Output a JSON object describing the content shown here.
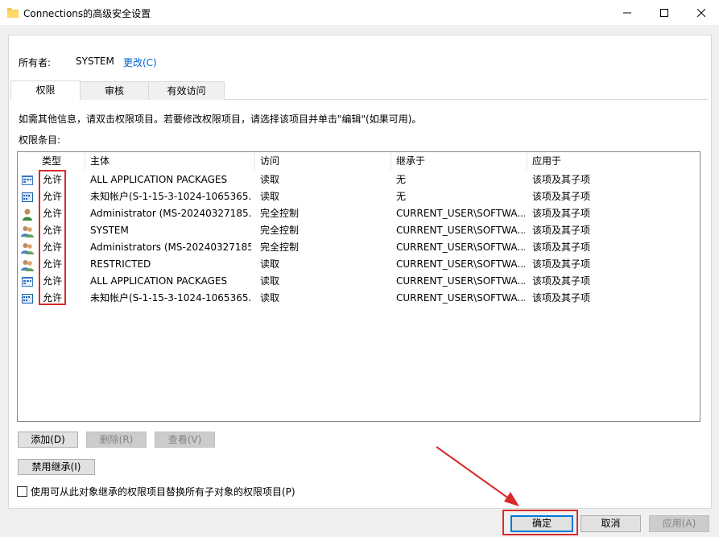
{
  "window": {
    "title": "Connections的高级安全设置",
    "minimize_icon": "minimize-icon",
    "maximize_icon": "maximize-icon",
    "close_icon": "close-icon"
  },
  "owner": {
    "label": "所有者:",
    "value": "SYSTEM",
    "change_link": "更改(C)"
  },
  "tabs": [
    {
      "label": "权限",
      "active": true
    },
    {
      "label": "审核",
      "active": false
    },
    {
      "label": "有效访问",
      "active": false
    }
  ],
  "info_text": "如需其他信息，请双击权限项目。若要修改权限项目，请选择该项目并单击\"编辑\"(如果可用)。",
  "entries_label": "权限条目:",
  "columns": [
    "类型",
    "主体",
    "访问",
    "继承于",
    "应用于"
  ],
  "rows": [
    {
      "icon": "app-package-icon",
      "type": "允许",
      "principal": "ALL APPLICATION PACKAGES",
      "access": "读取",
      "inherited": "无",
      "applies": "该项及其子项"
    },
    {
      "icon": "unknown-account-icon",
      "type": "允许",
      "principal": "未知帐户(S-1-15-3-1024-1065365...",
      "access": "读取",
      "inherited": "无",
      "applies": "该项及其子项"
    },
    {
      "icon": "user-icon",
      "type": "允许",
      "principal": "Administrator (MS-20240327185...",
      "access": "完全控制",
      "inherited": "CURRENT_USER\\SOFTWA...",
      "applies": "该项及其子项"
    },
    {
      "icon": "group-icon",
      "type": "允许",
      "principal": "SYSTEM",
      "access": "完全控制",
      "inherited": "CURRENT_USER\\SOFTWA...",
      "applies": "该项及其子项"
    },
    {
      "icon": "group-icon",
      "type": "允许",
      "principal": "Administrators (MS-20240327185...",
      "access": "完全控制",
      "inherited": "CURRENT_USER\\SOFTWA...",
      "applies": "该项及其子项"
    },
    {
      "icon": "group-icon",
      "type": "允许",
      "principal": "RESTRICTED",
      "access": "读取",
      "inherited": "CURRENT_USER\\SOFTWA...",
      "applies": "该项及其子项"
    },
    {
      "icon": "app-package-icon",
      "type": "允许",
      "principal": "ALL APPLICATION PACKAGES",
      "access": "读取",
      "inherited": "CURRENT_USER\\SOFTWA...",
      "applies": "该项及其子项"
    },
    {
      "icon": "unknown-account-icon",
      "type": "允许",
      "principal": "未知帐户(S-1-15-3-1024-1065365...",
      "access": "读取",
      "inherited": "CURRENT_USER\\SOFTWA...",
      "applies": "该项及其子项"
    }
  ],
  "buttons": {
    "add": "添加(D)",
    "remove": "删除(R)",
    "view": "查看(V)",
    "disable_inheritance": "禁用继承(I)",
    "ok": "确定",
    "cancel": "取消",
    "apply": "应用(A)"
  },
  "checkbox_label": "使用可从此对象继承的权限项目替换所有子对象的权限项目(P)",
  "colors": {
    "highlight_red": "#d92b2b",
    "link_blue": "#0066cc",
    "primary_border": "#0078d7"
  }
}
